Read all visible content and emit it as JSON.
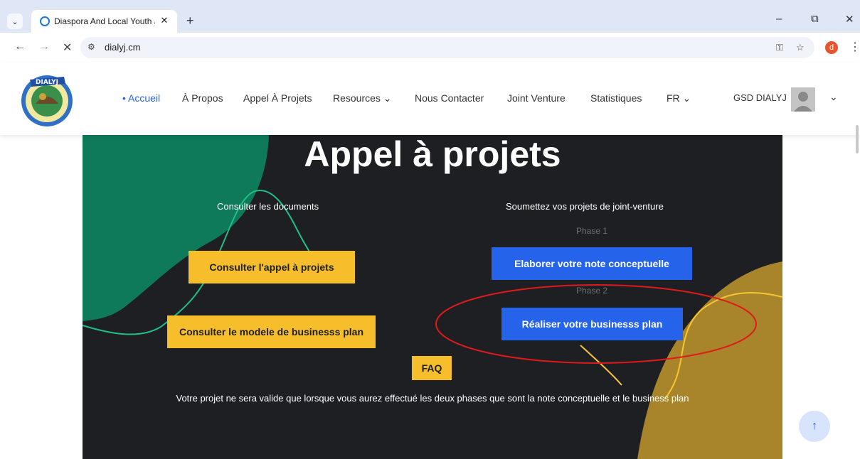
{
  "browser": {
    "tab_title": "Diaspora And Local Youth Joint",
    "tab_close": "✕",
    "new_tab": "+",
    "url": "dialyj.cm",
    "profile_initial": "d",
    "min": "–",
    "restore": "⧉",
    "close": "✕"
  },
  "nav": {
    "items": [
      "• Accueil",
      "À Propos",
      "Appel À Projets",
      "Resources ⌄",
      "Nous Contacter",
      "Joint Venture",
      "Statistiques",
      "FR ⌄"
    ],
    "active_index": 0,
    "user_name": "GSD DIALYJ"
  },
  "hero": {
    "title": "Appel à projets",
    "left_label": "Consulter les documents",
    "right_label": "Soumettez vos projets de joint-venture",
    "phase1": "Phase 1",
    "phase2": "Phase 2",
    "btn_appel": "Consulter l'appel à projets",
    "btn_modele": "Consulter le modele de businesss plan",
    "btn_note": "Elaborer votre note conceptuelle",
    "btn_business": "Réaliser votre businesss plan",
    "btn_faq": "FAQ",
    "note": "Votre projet ne sera valide que lorsque vous aurez effectué les deux phases que sont la note conceptuelle et le business plan"
  },
  "colors": {
    "accent_blue": "#2563eb",
    "button_yellow": "#f6be2a",
    "hero_bg": "#1e1f22",
    "green_blob": "#0f7a5a",
    "gold_blob": "#a8852a",
    "annotation_red": "#e01a1a"
  }
}
